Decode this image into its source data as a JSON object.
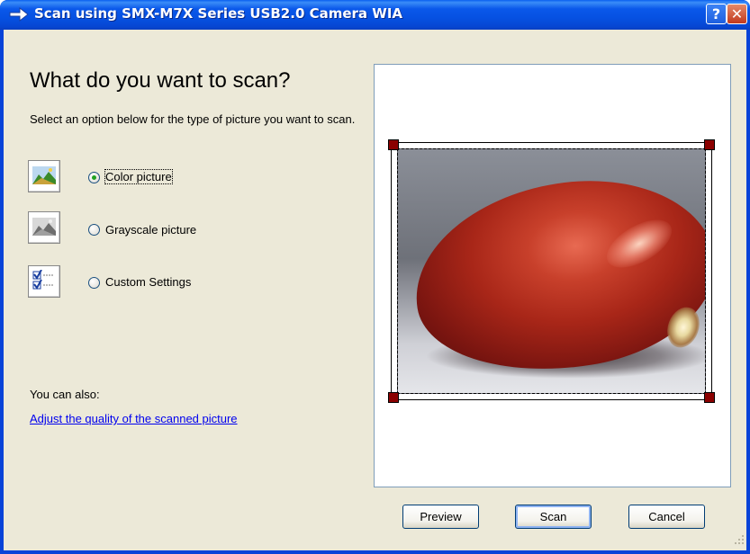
{
  "window": {
    "title": "Scan using SMX-M7X Series USB2.0 Camera WIA",
    "help_label": "?",
    "close_label": "✕"
  },
  "content": {
    "heading": "What do you want to scan?",
    "description": "Select an option below for the type of picture you want to scan.",
    "options": [
      {
        "label": "Color picture",
        "selected": true,
        "icon": "color-picture-icon"
      },
      {
        "label": "Grayscale picture",
        "selected": false,
        "icon": "grayscale-picture-icon"
      },
      {
        "label": "Custom Settings",
        "selected": false,
        "icon": "custom-settings-icon"
      }
    ],
    "also_label": "You can also:",
    "adjust_link": "Adjust the quality of the scanned picture"
  },
  "buttons": {
    "preview": "Preview",
    "scan": "Scan",
    "cancel": "Cancel"
  },
  "colors": {
    "titlebar": "#0a58ea",
    "dialog_bg": "#ece9d8",
    "link": "#0000ee",
    "crop_handle": "#8b0000"
  }
}
